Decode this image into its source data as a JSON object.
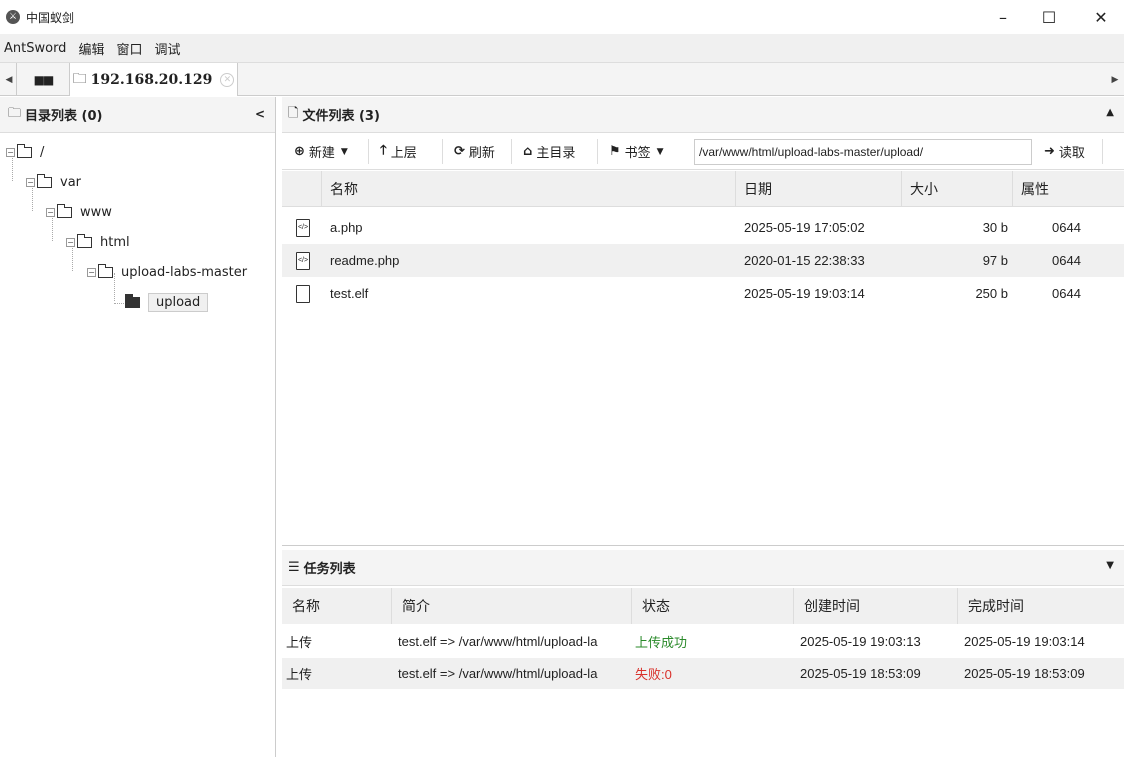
{
  "window": {
    "title": "中国蚁剑",
    "minimize": "–",
    "maximize": "☐",
    "close": "✕"
  },
  "menu": [
    "AntSword",
    "编辑",
    "窗口",
    "调试"
  ],
  "tabs": {
    "home_icon": "grid-icon",
    "active_label": "192.168.20.129"
  },
  "left_panel": {
    "title": "目录列表 (0)",
    "tree": [
      {
        "label": "/",
        "depth": 0
      },
      {
        "label": "var",
        "depth": 1
      },
      {
        "label": "www",
        "depth": 2
      },
      {
        "label": "html",
        "depth": 3
      },
      {
        "label": "upload-labs-master",
        "depth": 4
      },
      {
        "label": "upload",
        "depth": 5,
        "selected": true
      }
    ]
  },
  "file_panel": {
    "title": "文件列表 (3)",
    "toolbar": {
      "new": "新建",
      "up": "上层",
      "refresh": "刷新",
      "home": "主目录",
      "bookmark": "书签",
      "path": "/var/www/html/upload-labs-master/upload/",
      "read": "读取"
    },
    "columns": [
      "名称",
      "日期",
      "大小",
      "属性"
    ],
    "rows": [
      {
        "name": "a.php",
        "date": "2025-05-19 17:05:02",
        "size": "30 b",
        "attr": "0644",
        "icon": "php-file-icon"
      },
      {
        "name": "readme.php",
        "date": "2020-01-15 22:38:33",
        "size": "97 b",
        "attr": "0644",
        "icon": "php-file-icon"
      },
      {
        "name": "test.elf",
        "date": "2025-05-19 19:03:14",
        "size": "250 b",
        "attr": "0644",
        "icon": "file-icon"
      }
    ]
  },
  "task_panel": {
    "title": "任务列表",
    "columns": [
      "名称",
      "简介",
      "状态",
      "创建时间",
      "完成时间"
    ],
    "rows": [
      {
        "name": "上传",
        "desc": "test.elf => /var/www/html/upload-la",
        "status": "上传成功",
        "created": "2025-05-19 19:03:13",
        "finished": "2025-05-19 19:03:14"
      },
      {
        "name": "上传",
        "desc": "test.elf => /var/www/html/upload-la",
        "status": "失败:0",
        "created": "2025-05-19 18:53:09",
        "finished": "2025-05-19 18:53:09"
      }
    ]
  },
  "colors": {
    "success": "#2a8a2a",
    "fail": "#d9302a"
  }
}
